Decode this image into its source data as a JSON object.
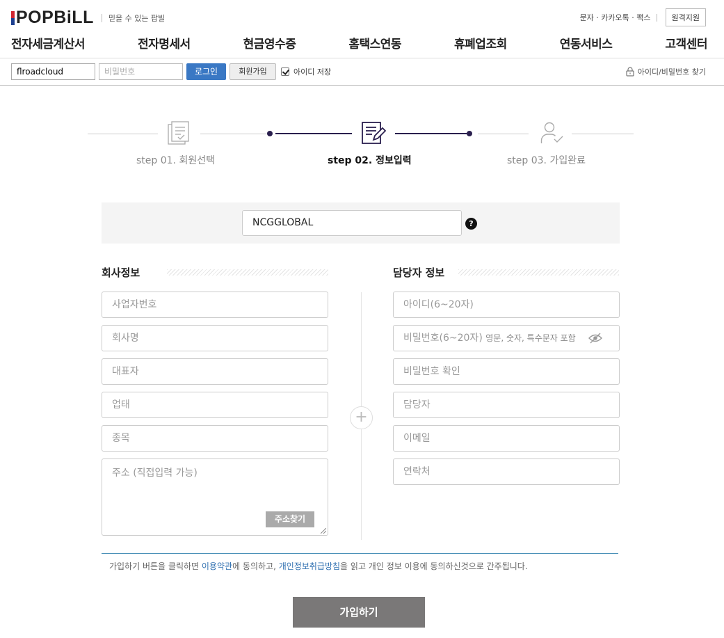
{
  "header": {
    "logo_text": "POPBiLL",
    "slogan": "믿을 수 있는 팝빌",
    "util_links": "문자 · 카카오톡 · 팩스",
    "remote_support": "원격지원"
  },
  "nav": {
    "items": [
      "전자세금계산서",
      "전자명세서",
      "현금영수증",
      "홈택스연동",
      "휴폐업조회",
      "연동서비스",
      "고객센터"
    ]
  },
  "login_bar": {
    "id_value": "flroadcloud",
    "pw_placeholder": "비밀번호",
    "login_button": "로그인",
    "join_button": "회원가입",
    "save_id_label": "아이디 저장",
    "save_id_checked": true,
    "find_label": "아이디/비밀번호 찾기"
  },
  "steps": [
    {
      "prefix": "step 01.",
      "label": "회원선택",
      "active": false
    },
    {
      "prefix": "step 02.",
      "label": "정보입력",
      "active": true
    },
    {
      "prefix": "step 03.",
      "label": "가입완료",
      "active": false
    }
  ],
  "form": {
    "partner_code": "NCGGLOBAL",
    "help_glyph": "?",
    "company_title": "회사정보",
    "contact_title": "담당자 정보",
    "company_fields": [
      "사업자번호",
      "회사명",
      "대표자",
      "업태",
      "종목"
    ],
    "address_placeholder": "주소 (직접입력 가능)",
    "address_button": "주소찾기",
    "contact_fields": {
      "id": "아이디(6~20자)",
      "password": "비밀번호(6~20자)",
      "password_hint": "영문, 숫자, 특수문자 포함",
      "password_confirm": "비밀번호 확인",
      "name": "담당자",
      "email": "이메일",
      "phone": "연락처"
    },
    "plus_glyph": "+"
  },
  "notice": {
    "before": "가입하기 버튼을 클릭하면 ",
    "terms_link": "이용약관",
    "middle": "에 동의하고, ",
    "privacy_link": "개인정보취급방침",
    "after": "을 읽고 개인 정보 이용에 동의하신것으로 간주됩니다."
  },
  "submit_button": "가입하기",
  "colors": {
    "brand_red": "#d0252f",
    "brand_blue": "#1d3f8f",
    "login_button": "#3a78c4",
    "step_active": "#2a1f4e",
    "submit": "#7a7878",
    "link": "#2f6fb0"
  }
}
